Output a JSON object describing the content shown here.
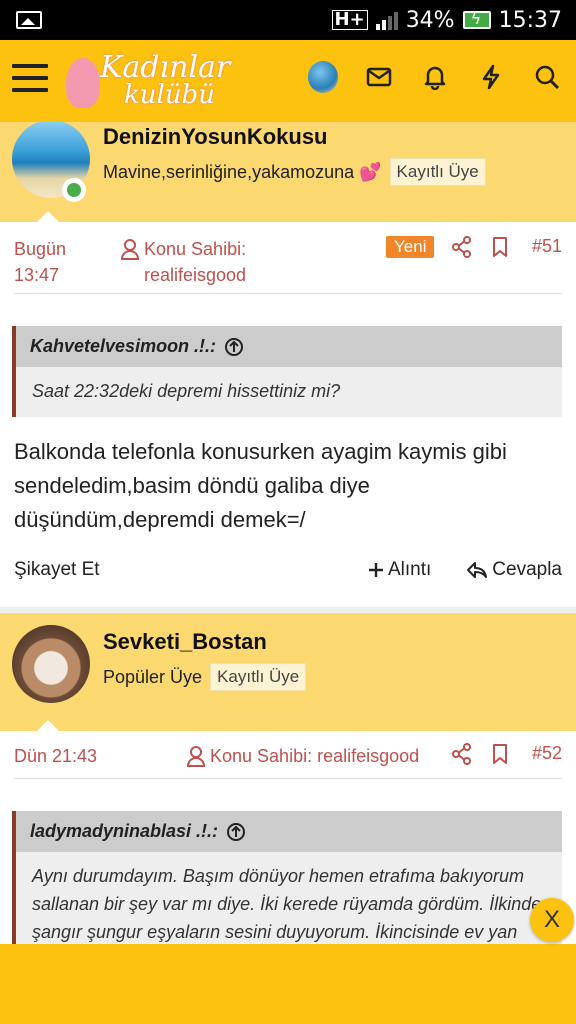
{
  "status_bar": {
    "network": "H+",
    "battery": "34%",
    "time": "15:37"
  },
  "app_bar": {
    "logo_line1": "Kadınlar",
    "logo_line2": "kulübü",
    "icons": [
      "menu-icon",
      "avatar",
      "mail-icon",
      "bell-icon",
      "bolt-icon",
      "search-icon"
    ],
    "bar_color": "#fdc20f"
  },
  "posts": [
    {
      "username": "DenizinYosunKokusu",
      "user_title": "Mavine,serinliğine,yakamozuna 💕",
      "badge": "Kayıtlı Üye",
      "date_line1": "Bugün",
      "date_line2": "13:47",
      "owner_label": "Konu Sahibi:",
      "owner_name": "realifeisgood",
      "new_label": "Yeni",
      "number": "#51",
      "quote_author": "Kahvetelvesimoon .!.:",
      "quote_text": "Saat 22:32deki depremi hissettiniz mi?",
      "body": "Balkonda telefonla konusurken ayagim kaymis gibi sendeledim,basim döndü galiba diye düşündüm,depremdi demek=/",
      "report": "Şikayet Et",
      "quote_btn": "Alıntı",
      "reply_btn": "Cevapla"
    },
    {
      "username": "Sevketi_Bostan",
      "user_title": "Popüler Üye",
      "badge": "Kayıtlı Üye",
      "date": "Dün 21:43",
      "owner_label": "Konu Sahibi: realifeisgood",
      "number": "#52",
      "quote_author": "ladymadyninablasi .!.:",
      "quote_text": "Aynı durumdayım. Başım dönüyor hemen etrafıma bakıyorum sallanan bir şey var mı diye. İki kerede rüyamda gördüm. İlkinde şangır şungur eşyaların sesini duyuyorum. İkincisinde ev yan yatıyordu. Rüyası bile korkunç. Allahım"
    }
  ],
  "close_ad": "X"
}
